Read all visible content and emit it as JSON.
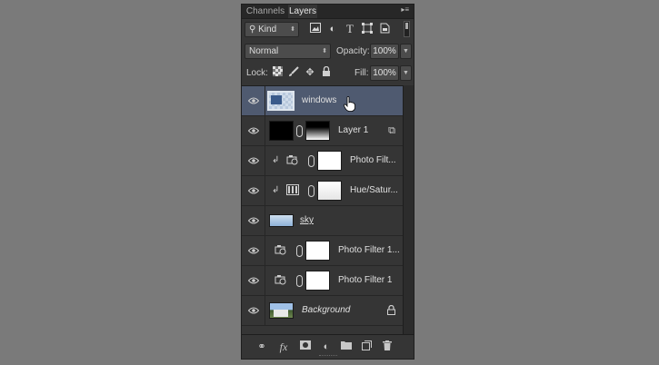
{
  "tabs": [
    {
      "label": "Channels",
      "active": false
    },
    {
      "label": "Layers",
      "active": true
    }
  ],
  "panel_menu_icon": "panel-menu-icon",
  "filter": {
    "kind_label": "Kind",
    "icons": [
      "pixel-filter-icon",
      "adjustment-filter-icon",
      "type-filter-icon",
      "shape-filter-icon",
      "smart-object-filter-icon"
    ]
  },
  "blend": {
    "mode": "Normal",
    "opacity_label": "Opacity:",
    "opacity_value": "100%"
  },
  "lock": {
    "label": "Lock:",
    "icons": [
      "lock-transparent-icon",
      "lock-image-icon",
      "lock-position-icon",
      "lock-all-icon"
    ],
    "fill_label": "Fill:",
    "fill_value": "100%"
  },
  "layers": [
    {
      "name": "windows",
      "selected": true
    },
    {
      "name": "Layer 1",
      "selected": false
    },
    {
      "name": "Photo Filt...",
      "selected": false
    },
    {
      "name": "Hue/Satur...",
      "selected": false
    },
    {
      "name": "sky",
      "selected": false
    },
    {
      "name": "Photo Filter 1...",
      "selected": false
    },
    {
      "name": "Photo Filter 1",
      "selected": false
    },
    {
      "name": "Background",
      "selected": false
    }
  ],
  "bottom_icons": [
    "link-layers-icon",
    "fx-icon",
    "add-mask-icon",
    "adjustment-layer-icon",
    "new-group-icon",
    "new-layer-icon",
    "trash-icon"
  ],
  "colors": {
    "selected_row": "#4f5a70",
    "panel_bg": "#353535"
  }
}
